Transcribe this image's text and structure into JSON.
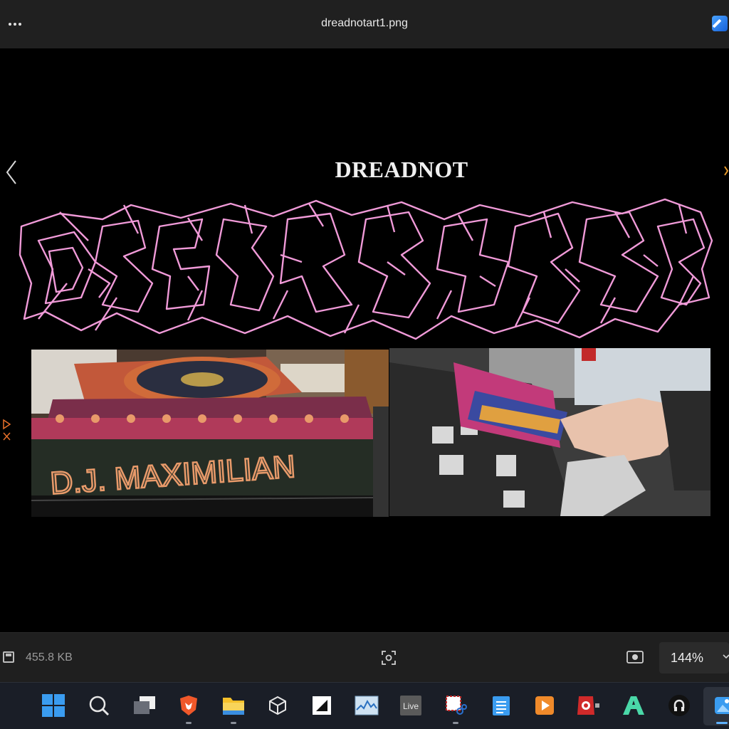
{
  "window": {
    "title": "dreadnotart1.png"
  },
  "image": {
    "heading": "DREADNOT",
    "left_photo_text": "D.J. MAXIMILIAN"
  },
  "status": {
    "file_size": "455.8 KB",
    "zoom": "144%"
  },
  "taskbar": {
    "live_label": "Live",
    "apps": [
      "windows-start",
      "search",
      "task-view",
      "brave-browser",
      "file-explorer",
      "3d-app",
      "capcut",
      "resource-monitor",
      "live-app",
      "snipping-tool",
      "notepad",
      "media-player",
      "screen-recorder",
      "a-app",
      "podcast-app",
      "photos"
    ]
  },
  "colors": {
    "graffiti": "#f09ad8",
    "accent": "#5fb2ff",
    "orange_text": "#e89a6a"
  }
}
